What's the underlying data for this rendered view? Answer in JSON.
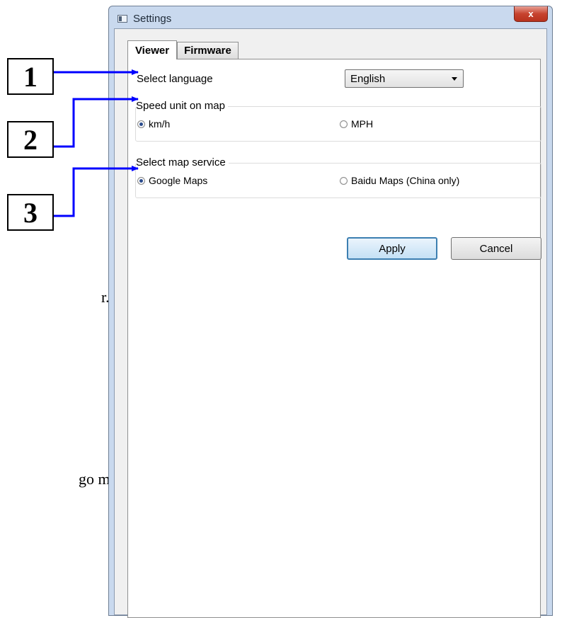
{
  "callouts": [
    "1",
    "2",
    "3"
  ],
  "doc_fragments": {
    "a": "r.",
    "b": "go mapy."
  },
  "window": {
    "title": "Settings",
    "close_symbol": "x"
  },
  "tabs": [
    {
      "label": "Viewer",
      "active": true
    },
    {
      "label": "Firmware",
      "active": false
    }
  ],
  "language": {
    "label": "Select language",
    "value": "English"
  },
  "speed_unit": {
    "title": "Speed unit on map",
    "options": [
      {
        "label": "km/h",
        "selected": true
      },
      {
        "label": "MPH",
        "selected": false
      }
    ]
  },
  "map_service": {
    "title": "Select map service",
    "options": [
      {
        "label": "Google Maps",
        "selected": true
      },
      {
        "label": "Baidu Maps (China only)",
        "selected": false
      }
    ]
  },
  "buttons": {
    "apply": "Apply",
    "cancel": "Cancel"
  },
  "colors": {
    "arrow": "#0000ff",
    "window_frame": "#c9d9ee",
    "close": "#c7432f",
    "apply_border": "#3c7fb1"
  }
}
